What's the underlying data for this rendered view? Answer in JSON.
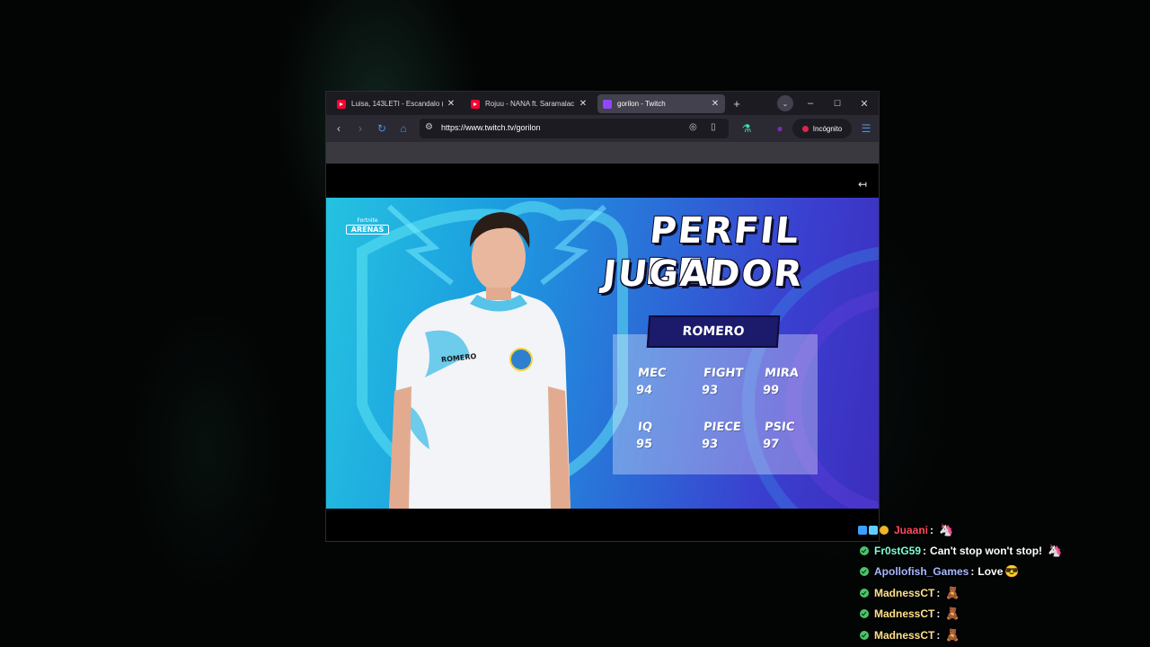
{
  "browser": {
    "tabs": [
      {
        "title": "Luisa, 143LETI - Escandalo (",
        "favicon": "youtube-icon",
        "active": false
      },
      {
        "title": "Rojuu - NANA ft. Saramalac",
        "favicon": "youtube-icon",
        "active": false
      },
      {
        "title": "gorilon - Twitch",
        "favicon": "twitch-icon",
        "active": true
      }
    ],
    "new_tab": "+",
    "url": "https://www.twitch.tv/gorilon",
    "incognito_label": "Incógnito"
  },
  "stream": {
    "logo_small": "Fortnite",
    "logo_big": "ARENAS",
    "headline_line1": "PERFIL DEL",
    "headline_line2": "JUGADOR",
    "player_name": "ROMERO",
    "jersey_name": "ROMERO",
    "stats": [
      {
        "label": "MEC",
        "value": "94"
      },
      {
        "label": "FIGHT",
        "value": "93"
      },
      {
        "label": "MIRA",
        "value": "99"
      },
      {
        "label": "IQ",
        "value": "95"
      },
      {
        "label": "PIECE",
        "value": "93"
      },
      {
        "label": "PSIC",
        "value": "97"
      }
    ],
    "colors": {
      "bg_start": "#25c2e0",
      "bg_end": "#3d2dbd",
      "name_tag": "#1c1a6b"
    }
  },
  "chat": [
    {
      "user": "Juaani",
      "color": "#ff4a5a",
      "message": "",
      "emote": "🦄",
      "badges": "multi"
    },
    {
      "user": "Fr0stG59",
      "color": "#7fffd4",
      "message": "Can't stop won't stop!",
      "emote": "🦄",
      "badges": "check"
    },
    {
      "user": "Apollofish_Games",
      "color": "#a9b9ff",
      "message": "Love",
      "emote": "😎",
      "badges": "check"
    },
    {
      "user": "MadnessCT",
      "color": "#ffe08a",
      "message": "",
      "emote": "🧸",
      "badges": "check"
    },
    {
      "user": "MadnessCT",
      "color": "#ffe08a",
      "message": "",
      "emote": "🧸",
      "badges": "check"
    },
    {
      "user": "MadnessCT",
      "color": "#ffe08a",
      "message": "",
      "emote": "🧸",
      "badges": "check"
    }
  ]
}
